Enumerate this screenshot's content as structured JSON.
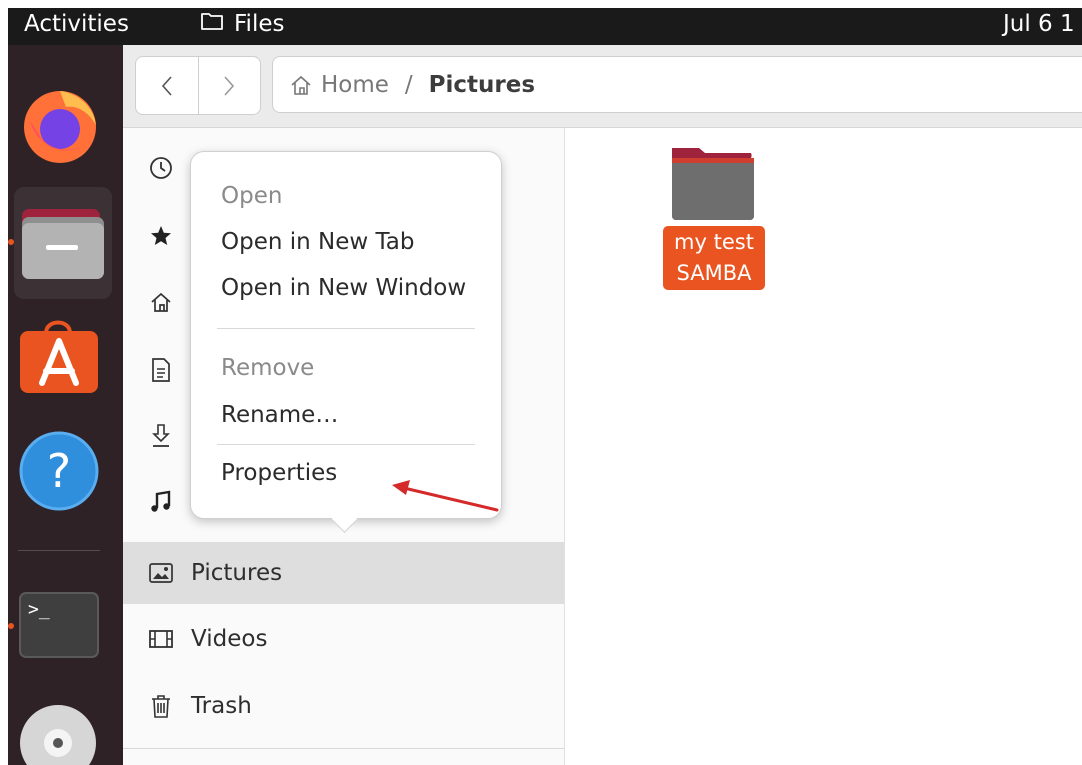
{
  "topbar": {
    "activities": "Activities",
    "app_name": "Files",
    "clock": "Jul 6  1"
  },
  "dock": {
    "items": [
      {
        "name": "firefox"
      },
      {
        "name": "files",
        "running": true
      },
      {
        "name": "ubuntu-software"
      },
      {
        "name": "help"
      },
      {
        "name": "terminal",
        "running": true
      },
      {
        "name": "disc"
      }
    ]
  },
  "header": {
    "back_icon": "chevron-left-icon",
    "forward_icon": "chevron-right-icon",
    "path": {
      "home_icon": "home-icon",
      "home_label": "Home",
      "separator": "/",
      "current": "Pictures"
    }
  },
  "sidebar": {
    "items": [
      {
        "icon": "recent-icon",
        "label": ""
      },
      {
        "icon": "starred-icon",
        "label": ""
      },
      {
        "icon": "home-icon",
        "label": ""
      },
      {
        "icon": "documents-icon",
        "label": ""
      },
      {
        "icon": "downloads-icon",
        "label": ""
      },
      {
        "icon": "music-icon",
        "label": ""
      },
      {
        "icon": "pictures-icon",
        "label": "Pictures",
        "active": true
      },
      {
        "icon": "videos-icon",
        "label": "Videos"
      },
      {
        "icon": "trash-icon",
        "label": "Trash"
      }
    ]
  },
  "content": {
    "folder": {
      "name": "my test SAMBA",
      "line1": "my test",
      "line2": "SAMBA",
      "selected": true
    }
  },
  "context_menu": {
    "items": [
      {
        "label": "Open",
        "enabled": false
      },
      {
        "label": "Open in New Tab",
        "enabled": true
      },
      {
        "label": "Open in New Window",
        "enabled": true
      },
      {
        "label": "Remove",
        "enabled": false
      },
      {
        "label": "Rename…",
        "enabled": true
      },
      {
        "label": "Properties",
        "enabled": true
      }
    ]
  },
  "colors": {
    "accent": "#e95420",
    "dock_bg": "#2e2227",
    "topbar_bg": "#1a1a1a",
    "annotation_arrow": "#d42a2a"
  }
}
